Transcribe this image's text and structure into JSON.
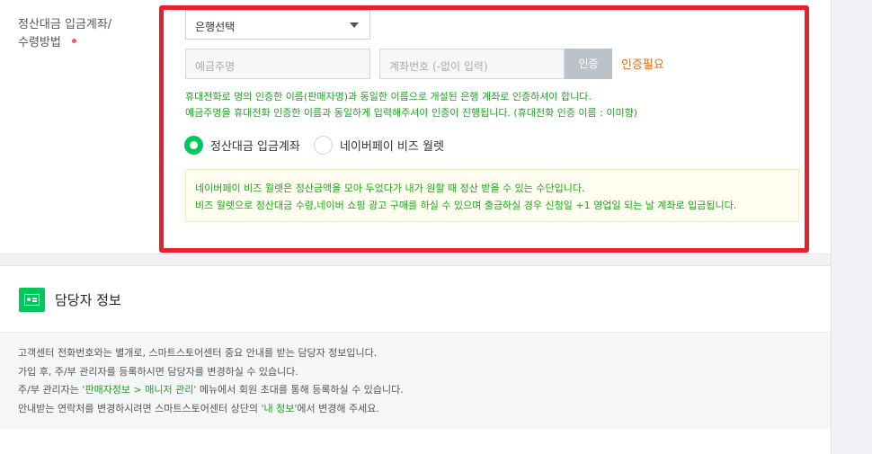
{
  "settlement": {
    "label_line1": "정산대금 입금계좌/",
    "label_line2": "수령방법",
    "bank_select": {
      "value": "은행선택"
    },
    "holder_input": {
      "placeholder": "예금주명"
    },
    "account_input": {
      "placeholder": "계좌번호 (-없이 입력)"
    },
    "auth_button": "인증",
    "auth_status": "인증필요",
    "notice_line1": "휴대전화로 명의 인증한 이름(판매자명)과 동일한 이름으로 개설된 은행 계좌로 인증하셔야 합니다.",
    "notice_line2": "예금주명을 휴대전화 인증한 이름과 동일하게 입력해주셔야 인증이 진행됩니다. (휴대전화 인증 이름 : 이미향)",
    "options": [
      {
        "label": "정산대금 입금계좌",
        "selected": true
      },
      {
        "label": "네이버페이 비즈 월렛",
        "selected": false
      }
    ],
    "wallet_info_line1": "네이버페이 비즈 월렛은 정산금액을 모아 두었다가 내가 원할 때 정산 받을 수 있는 수단입니다.",
    "wallet_info_line2": "비즈 월렛으로 정산대금 수령,네이버 쇼핑 광고 구매를 하실 수 있으며 출금하실 경우 신청일 +1 영업일 되는 날 계좌로 입금됩니다."
  },
  "manager_section": {
    "icon": "id-card-icon",
    "title": "담당자 정보",
    "line1": "고객센터 전화번호와는 별개로, 스마트스토어센터 중요 안내를 받는 담당자 정보입니다.",
    "line2": "가입 후, 주/부 관리자를 등록하시면 담당자를 변경하실 수 있습니다.",
    "line3_prefix": "주/부 관리자는 ",
    "line3_highlight": "'판매자정보 > 매니저 관리'",
    "line3_suffix": " 메뉴에서 회원 초대를 통해 등록하실 수 있습니다.",
    "line4_prefix": "안내받는 연락처를 변경하시려면 스마트스토어센터 상단의 ",
    "line4_highlight": "'내 정보'",
    "line4_suffix": "에서 변경해 주세요."
  },
  "colors": {
    "accent_green": "#03c75a",
    "notice_green": "#1ba51e",
    "highlight_red": "#e8202a",
    "status_orange": "#e1701d"
  }
}
